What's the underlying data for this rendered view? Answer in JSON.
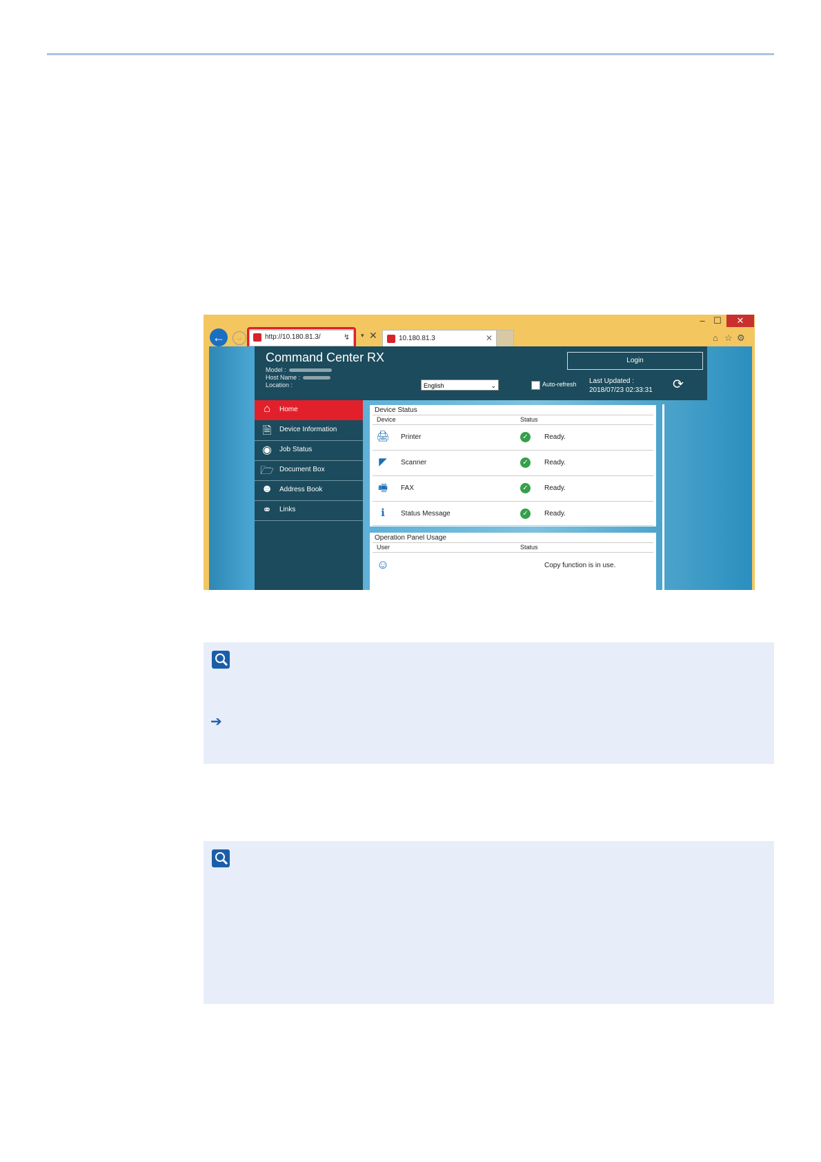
{
  "browser": {
    "window_controls": {
      "minimize": "–",
      "maximize": "☐",
      "close": "✕"
    },
    "address": "http://10.180.81.3/",
    "tab_title": "10.180.81.3",
    "icons": [
      "back-arrow",
      "forward-arrow",
      "home",
      "star",
      "gear"
    ]
  },
  "app": {
    "title": "Command Center RX",
    "meta": {
      "model_label": "Model :",
      "host_label": "Host Name :",
      "location_label": "Location :"
    },
    "login_label": "Login",
    "language": "English",
    "auto_refresh_label": "Auto-refresh",
    "last_updated_label": "Last Updated :",
    "last_updated_value": "2018/07/23 02:33:31"
  },
  "sidebar": {
    "items": [
      {
        "label": "Home",
        "icon": "home-icon",
        "active": true
      },
      {
        "label": "Device Information",
        "icon": "device-info-icon"
      },
      {
        "label": "Job Status",
        "icon": "eye-icon"
      },
      {
        "label": "Document Box",
        "icon": "folder-icon"
      },
      {
        "label": "Address Book",
        "icon": "address-book-icon"
      },
      {
        "label": "Links",
        "icon": "link-icon"
      }
    ]
  },
  "device_status": {
    "title": "Device Status",
    "col_device": "Device",
    "col_status": "Status",
    "rows": [
      {
        "name": "Printer",
        "status": "Ready."
      },
      {
        "name": "Scanner",
        "status": "Ready."
      },
      {
        "name": "FAX",
        "status": "Ready."
      },
      {
        "name": "Status Message",
        "status": "Ready."
      }
    ]
  },
  "operation_panel": {
    "title": "Operation Panel Usage",
    "col_user": "User",
    "col_status": "Status",
    "rows": [
      {
        "status": "Copy function is in use."
      }
    ]
  },
  "colors": {
    "rule": "#a9c3e8",
    "header": "#1b4b5c",
    "active": "#e2202c",
    "highlight": "#e0202a",
    "note_bg": "#e7edf9",
    "note_icon": "#1b5ea8"
  }
}
